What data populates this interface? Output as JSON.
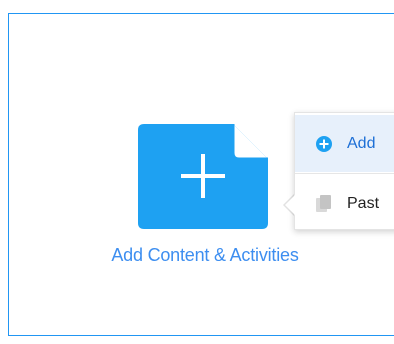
{
  "add_tile": {
    "label": "Add Content & Activities",
    "icon": "plus-icon",
    "tile_color": "#1ea1f2"
  },
  "menu": {
    "items": [
      {
        "label": "Add",
        "icon": "plus-circle-icon"
      },
      {
        "label": "Past",
        "icon": "paste-icon"
      }
    ]
  },
  "colors": {
    "accent": "#2196f3",
    "label": "#3d8ef0",
    "menu_highlight": "#e7f0fb"
  }
}
